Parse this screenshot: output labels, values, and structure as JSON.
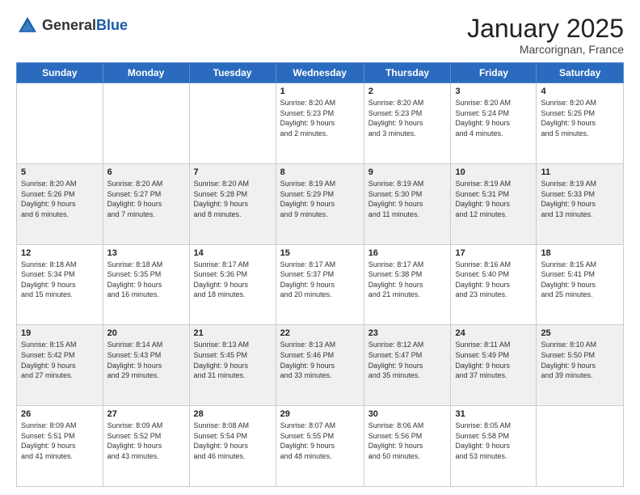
{
  "header": {
    "logo_general": "General",
    "logo_blue": "Blue",
    "month_title": "January 2025",
    "location": "Marcorignan, France"
  },
  "weekdays": [
    "Sunday",
    "Monday",
    "Tuesday",
    "Wednesday",
    "Thursday",
    "Friday",
    "Saturday"
  ],
  "weeks": [
    [
      {
        "day": "",
        "info": ""
      },
      {
        "day": "",
        "info": ""
      },
      {
        "day": "",
        "info": ""
      },
      {
        "day": "1",
        "info": "Sunrise: 8:20 AM\nSunset: 5:23 PM\nDaylight: 9 hours\nand 2 minutes."
      },
      {
        "day": "2",
        "info": "Sunrise: 8:20 AM\nSunset: 5:23 PM\nDaylight: 9 hours\nand 3 minutes."
      },
      {
        "day": "3",
        "info": "Sunrise: 8:20 AM\nSunset: 5:24 PM\nDaylight: 9 hours\nand 4 minutes."
      },
      {
        "day": "4",
        "info": "Sunrise: 8:20 AM\nSunset: 5:25 PM\nDaylight: 9 hours\nand 5 minutes."
      }
    ],
    [
      {
        "day": "5",
        "info": "Sunrise: 8:20 AM\nSunset: 5:26 PM\nDaylight: 9 hours\nand 6 minutes."
      },
      {
        "day": "6",
        "info": "Sunrise: 8:20 AM\nSunset: 5:27 PM\nDaylight: 9 hours\nand 7 minutes."
      },
      {
        "day": "7",
        "info": "Sunrise: 8:20 AM\nSunset: 5:28 PM\nDaylight: 9 hours\nand 8 minutes."
      },
      {
        "day": "8",
        "info": "Sunrise: 8:19 AM\nSunset: 5:29 PM\nDaylight: 9 hours\nand 9 minutes."
      },
      {
        "day": "9",
        "info": "Sunrise: 8:19 AM\nSunset: 5:30 PM\nDaylight: 9 hours\nand 11 minutes."
      },
      {
        "day": "10",
        "info": "Sunrise: 8:19 AM\nSunset: 5:31 PM\nDaylight: 9 hours\nand 12 minutes."
      },
      {
        "day": "11",
        "info": "Sunrise: 8:19 AM\nSunset: 5:33 PM\nDaylight: 9 hours\nand 13 minutes."
      }
    ],
    [
      {
        "day": "12",
        "info": "Sunrise: 8:18 AM\nSunset: 5:34 PM\nDaylight: 9 hours\nand 15 minutes."
      },
      {
        "day": "13",
        "info": "Sunrise: 8:18 AM\nSunset: 5:35 PM\nDaylight: 9 hours\nand 16 minutes."
      },
      {
        "day": "14",
        "info": "Sunrise: 8:17 AM\nSunset: 5:36 PM\nDaylight: 9 hours\nand 18 minutes."
      },
      {
        "day": "15",
        "info": "Sunrise: 8:17 AM\nSunset: 5:37 PM\nDaylight: 9 hours\nand 20 minutes."
      },
      {
        "day": "16",
        "info": "Sunrise: 8:17 AM\nSunset: 5:38 PM\nDaylight: 9 hours\nand 21 minutes."
      },
      {
        "day": "17",
        "info": "Sunrise: 8:16 AM\nSunset: 5:40 PM\nDaylight: 9 hours\nand 23 minutes."
      },
      {
        "day": "18",
        "info": "Sunrise: 8:15 AM\nSunset: 5:41 PM\nDaylight: 9 hours\nand 25 minutes."
      }
    ],
    [
      {
        "day": "19",
        "info": "Sunrise: 8:15 AM\nSunset: 5:42 PM\nDaylight: 9 hours\nand 27 minutes."
      },
      {
        "day": "20",
        "info": "Sunrise: 8:14 AM\nSunset: 5:43 PM\nDaylight: 9 hours\nand 29 minutes."
      },
      {
        "day": "21",
        "info": "Sunrise: 8:13 AM\nSunset: 5:45 PM\nDaylight: 9 hours\nand 31 minutes."
      },
      {
        "day": "22",
        "info": "Sunrise: 8:13 AM\nSunset: 5:46 PM\nDaylight: 9 hours\nand 33 minutes."
      },
      {
        "day": "23",
        "info": "Sunrise: 8:12 AM\nSunset: 5:47 PM\nDaylight: 9 hours\nand 35 minutes."
      },
      {
        "day": "24",
        "info": "Sunrise: 8:11 AM\nSunset: 5:49 PM\nDaylight: 9 hours\nand 37 minutes."
      },
      {
        "day": "25",
        "info": "Sunrise: 8:10 AM\nSunset: 5:50 PM\nDaylight: 9 hours\nand 39 minutes."
      }
    ],
    [
      {
        "day": "26",
        "info": "Sunrise: 8:09 AM\nSunset: 5:51 PM\nDaylight: 9 hours\nand 41 minutes."
      },
      {
        "day": "27",
        "info": "Sunrise: 8:09 AM\nSunset: 5:52 PM\nDaylight: 9 hours\nand 43 minutes."
      },
      {
        "day": "28",
        "info": "Sunrise: 8:08 AM\nSunset: 5:54 PM\nDaylight: 9 hours\nand 46 minutes."
      },
      {
        "day": "29",
        "info": "Sunrise: 8:07 AM\nSunset: 5:55 PM\nDaylight: 9 hours\nand 48 minutes."
      },
      {
        "day": "30",
        "info": "Sunrise: 8:06 AM\nSunset: 5:56 PM\nDaylight: 9 hours\nand 50 minutes."
      },
      {
        "day": "31",
        "info": "Sunrise: 8:05 AM\nSunset: 5:58 PM\nDaylight: 9 hours\nand 53 minutes."
      },
      {
        "day": "",
        "info": ""
      }
    ]
  ],
  "shading": [
    false,
    true,
    false,
    true,
    false
  ]
}
